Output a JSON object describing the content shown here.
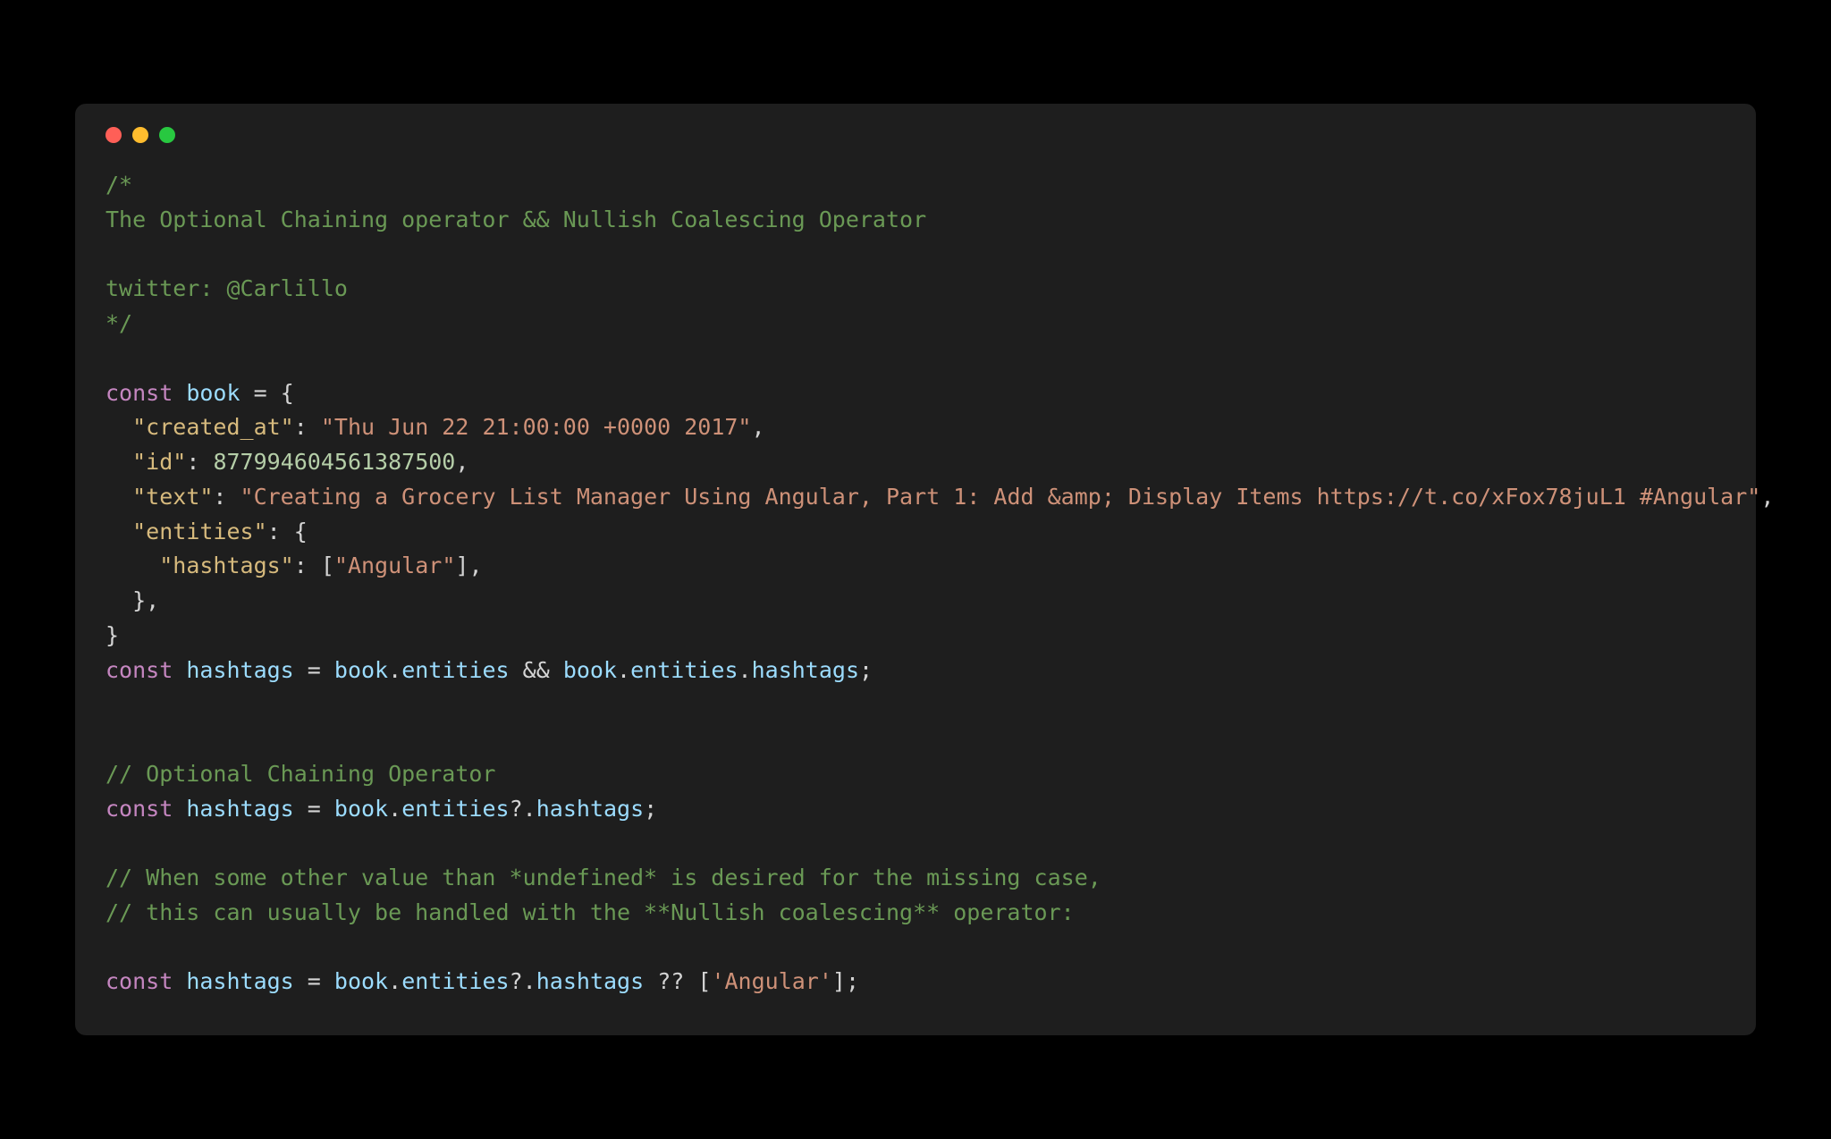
{
  "code": {
    "comment1_l1": "/*",
    "comment1_l2": "The Optional Chaining operator && Nullish Coalescing Operator",
    "comment1_l3": "",
    "comment1_l4": "twitter: @Carlillo",
    "comment1_l5": "*/",
    "kw_const": "const",
    "id_book": "book",
    "eq": " = ",
    "br_open": "{",
    "key_created": "\"created_at\"",
    "val_created": "\"Thu Jun 22 21:00:00 +0000 2017\"",
    "key_id": "\"id\"",
    "val_id": "877994604561387500",
    "key_text": "\"text\"",
    "val_text": "\"Creating a Grocery List Manager Using Angular, Part 1: Add &amp; Display Items https://t.co/xFox78juL1 #Angular\"",
    "key_entities": "\"entities\"",
    "key_hashtags": "\"hashtags\"",
    "arr_open": "[",
    "val_angular": "\"Angular\"",
    "arr_close": "]",
    "br_close": "}",
    "comma": ",",
    "colon": ": ",
    "id_hashtags": "hashtags",
    "dot": ".",
    "id_entities": "entities",
    "op_and": " && ",
    "semi": ";",
    "comment2": "// Optional Chaining Operator",
    "qmark": "?",
    "comment3_l1": "// When some other value than *undefined* is desired for the missing case,",
    "comment3_l2": "// this can usually be handled with the **Nullish coalescing** operator:",
    "op_nullish": " ?? ",
    "str_angular2": "'Angular'"
  }
}
